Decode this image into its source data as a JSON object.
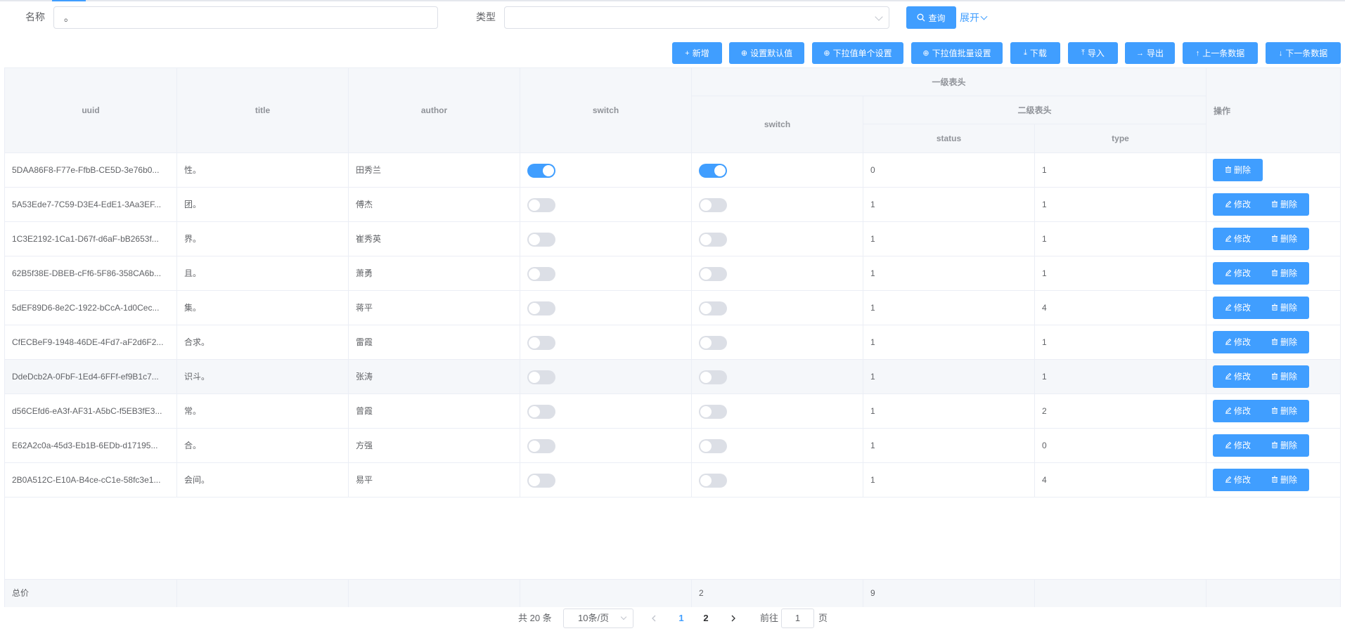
{
  "search": {
    "name_label": "名称",
    "name_value": "。",
    "type_label": "类型",
    "type_value": "",
    "query_button": "查询",
    "expand_link": "展开"
  },
  "toolbar": {
    "buttons": [
      {
        "icon": "plus-icon",
        "glyph": "+",
        "label": "新增"
      },
      {
        "icon": "circle-setting-icon",
        "glyph": "⊕",
        "label": "设置默认值"
      },
      {
        "icon": "circle-setting-icon",
        "glyph": "⊕",
        "label": "下拉值单个设置"
      },
      {
        "icon": "circle-setting-icon",
        "glyph": "⊕",
        "label": "下拉值批量设置"
      },
      {
        "icon": "download-icon",
        "glyph": "⤓",
        "label": "下载"
      },
      {
        "icon": "upload-icon",
        "glyph": "⤒",
        "label": "导入"
      },
      {
        "icon": "arrow-right-icon",
        "glyph": "→",
        "label": "导出"
      },
      {
        "icon": "arrow-up-icon",
        "glyph": "↑",
        "label": "上一条数据"
      },
      {
        "icon": "arrow-down-icon",
        "glyph": "↓",
        "label": "下一条数据"
      }
    ]
  },
  "table": {
    "headers": {
      "uuid": "uuid",
      "title": "title",
      "author": "author",
      "switch": "switch",
      "group1": "一级表头",
      "switch2": "switch",
      "group2": "二级表头",
      "status": "status",
      "type": "type",
      "ops": "操作"
    },
    "edit_label": "修改",
    "delete_label": "删除",
    "rows": [
      {
        "uuid": "5DAA86F8-F77e-FfbB-CE5D-3e76b0...",
        "title": "性。",
        "author": "田秀兰",
        "switch": true,
        "switch2": true,
        "status": "0",
        "type": "1",
        "editable": false,
        "highlight": false
      },
      {
        "uuid": "5A53Ede7-7C59-D3E4-EdE1-3Aa3EF...",
        "title": "团。",
        "author": "傅杰",
        "switch": false,
        "switch2": false,
        "status": "1",
        "type": "1",
        "editable": true,
        "highlight": false
      },
      {
        "uuid": "1C3E2192-1Ca1-D67f-d6aF-bB2653f...",
        "title": "界。",
        "author": "崔秀英",
        "switch": false,
        "switch2": false,
        "status": "1",
        "type": "1",
        "editable": true,
        "highlight": false
      },
      {
        "uuid": "62B5f38E-DBEB-cFf6-5F86-358CA6b...",
        "title": "且。",
        "author": "萧勇",
        "switch": false,
        "switch2": false,
        "status": "1",
        "type": "1",
        "editable": true,
        "highlight": false
      },
      {
        "uuid": "5dEF89D6-8e2C-1922-bCcA-1d0Cec...",
        "title": "集。",
        "author": "蒋平",
        "switch": false,
        "switch2": false,
        "status": "1",
        "type": "4",
        "editable": true,
        "highlight": false
      },
      {
        "uuid": "CfECBeF9-1948-46DE-4Fd7-aF2d6F2...",
        "title": "合求。",
        "author": "雷霞",
        "switch": false,
        "switch2": false,
        "status": "1",
        "type": "1",
        "editable": true,
        "highlight": false
      },
      {
        "uuid": "DdeDcb2A-0FbF-1Ed4-6FFf-ef9B1c7...",
        "title": "识斗。",
        "author": "张涛",
        "switch": false,
        "switch2": false,
        "status": "1",
        "type": "1",
        "editable": true,
        "highlight": true
      },
      {
        "uuid": "d56CEfd6-eA3f-AF31-A5bC-f5EB3fE3...",
        "title": "常。",
        "author": "曾霞",
        "switch": false,
        "switch2": false,
        "status": "1",
        "type": "2",
        "editable": true,
        "highlight": false
      },
      {
        "uuid": "E62A2c0a-45d3-Eb1B-6EDb-d17195...",
        "title": "合。",
        "author": "方强",
        "switch": false,
        "switch2": false,
        "status": "1",
        "type": "0",
        "editable": true,
        "highlight": false
      },
      {
        "uuid": "2B0A512C-E10A-B4ce-cC1e-58fc3e1...",
        "title": "会间。",
        "author": "易平",
        "switch": false,
        "switch2": false,
        "status": "1",
        "type": "4",
        "editable": true,
        "highlight": false
      }
    ],
    "footer": {
      "label": "总价",
      "switch2_sum": "2",
      "status_sum": "9"
    }
  },
  "pagination": {
    "total": "共 20 条",
    "page_size": "10条/页",
    "pages": [
      "1",
      "2"
    ],
    "current": "1",
    "goto_label": "前往",
    "goto_value": "1",
    "page_suffix": "页"
  },
  "colors": {
    "primary": "#409eff",
    "header_bg": "#f5f7fa",
    "border": "#ebeef5"
  }
}
